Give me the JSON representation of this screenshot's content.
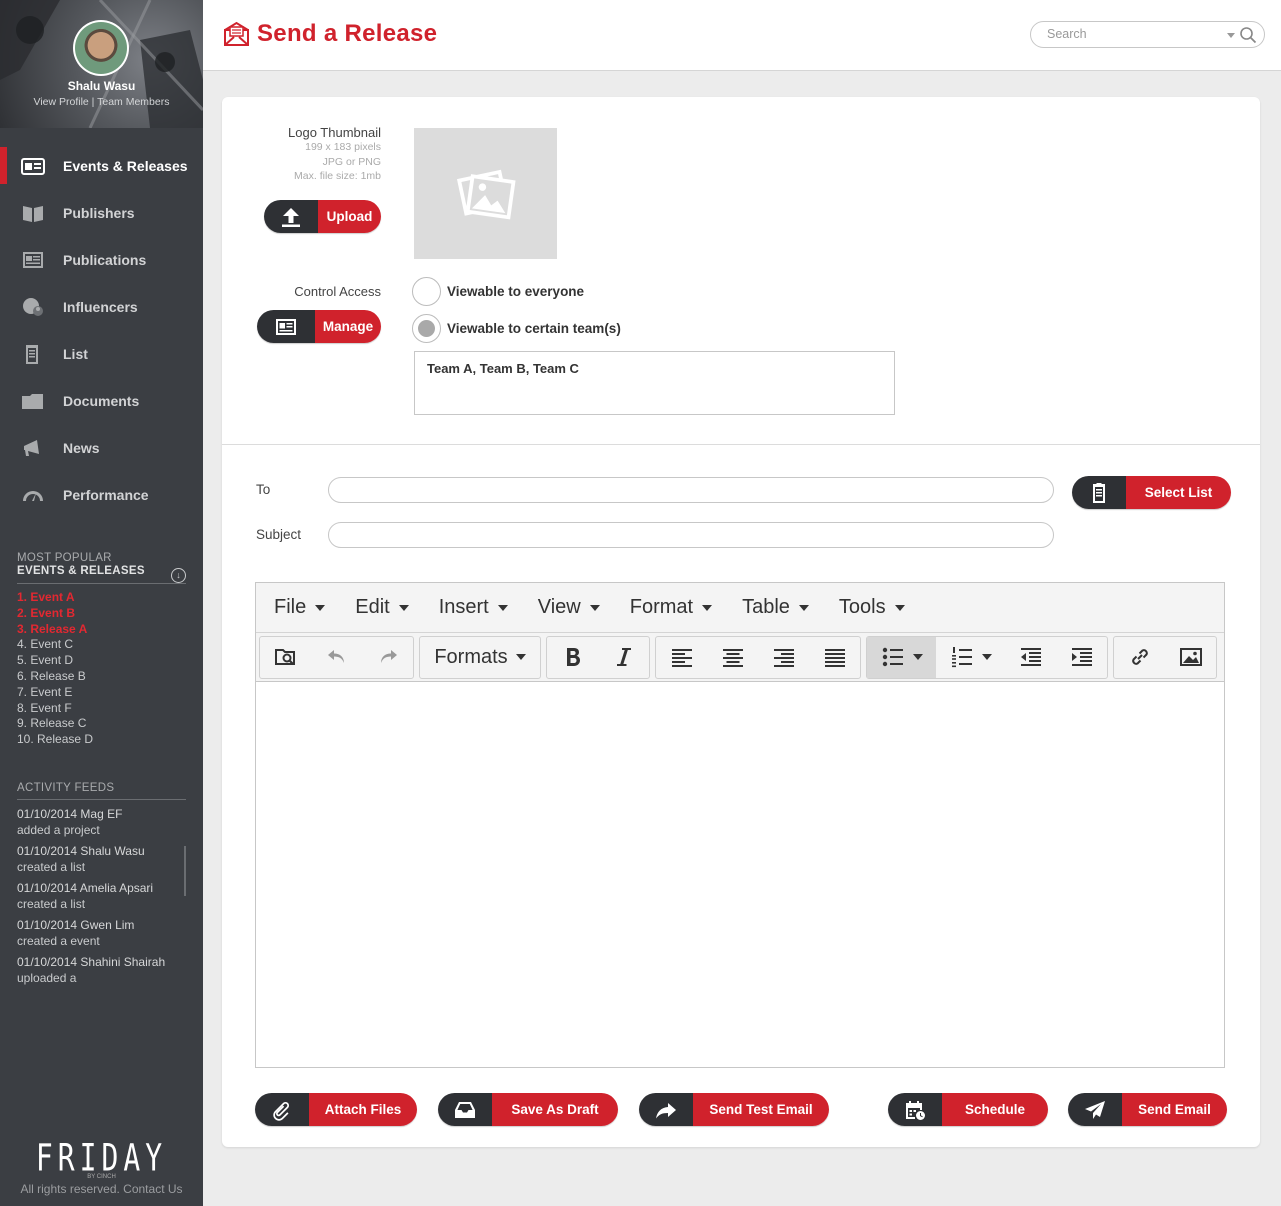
{
  "profile": {
    "name": "Shalu Wasu",
    "links": "View Profile | Team Members"
  },
  "nav": [
    {
      "label": "Events & Releases",
      "icon": "events-icon",
      "active": true
    },
    {
      "label": "Publishers",
      "icon": "book-icon"
    },
    {
      "label": "Publications",
      "icon": "newspaper-icon"
    },
    {
      "label": "Influencers",
      "icon": "influencers-icon"
    },
    {
      "label": "List",
      "icon": "clipboard-icon"
    },
    {
      "label": "Documents",
      "icon": "folder-icon"
    },
    {
      "label": "News",
      "icon": "megaphone-icon"
    },
    {
      "label": "Performance",
      "icon": "gauge-icon"
    }
  ],
  "popular": {
    "heading_line1": "MOST POPULAR",
    "heading_line2": "EVENTS & RELEASES",
    "items": [
      "1. Event A",
      "2. Event B",
      "3. Release A",
      "4. Event C",
      "5. Event D",
      "6. Release B",
      "7. Event E",
      "8. Event F",
      "9. Release C",
      "10. Release D"
    ]
  },
  "feeds": {
    "heading": "ACTIVITY FEEDS",
    "items": [
      {
        "line1": "01/10/2014 Mag EF",
        "line2": "added a project"
      },
      {
        "line1": "01/10/2014 Shalu Wasu",
        "line2": "created a list"
      },
      {
        "line1": "01/10/2014 Amelia Apsari",
        "line2": "created a list"
      },
      {
        "line1": "01/10/2014 Gwen Lim",
        "line2": "created a event"
      },
      {
        "line1": "01/10/2014 Shahini Shairah",
        "line2": "uploaded a"
      }
    ]
  },
  "brand": {
    "logo": "FRIDAY",
    "by": "BY CINCH",
    "footer": "All rights reserved. Contact Us"
  },
  "header": {
    "title": "Send a Release",
    "search_placeholder": "Search"
  },
  "logo_section": {
    "label": "Logo Thumbnail",
    "hint1": "199 x 183 pixels",
    "hint2": "JPG or PNG",
    "hint3": "Max. file size: 1mb",
    "upload_label": "Upload"
  },
  "access": {
    "label": "Control Access",
    "manage_label": "Manage",
    "option_everyone": "Viewable to everyone",
    "option_teams": "Viewable to certain team(s)",
    "selected": "teams",
    "teams_value": "Team A, Team B, Team C"
  },
  "compose": {
    "to_label": "To",
    "subject_label": "Subject",
    "to_value": "",
    "subject_value": "",
    "select_list_label": "Select List"
  },
  "editor": {
    "menus": [
      "File",
      "Edit",
      "Insert",
      "View",
      "Format",
      "Table",
      "Tools"
    ],
    "formats_label": "Formats"
  },
  "actions": {
    "attach": "Attach Files",
    "draft": "Save As Draft",
    "test": "Send Test Email",
    "schedule": "Schedule",
    "send": "Send Email"
  },
  "colors": {
    "accent": "#d0222c",
    "sidebar": "#3b3e43",
    "pill_icon": "#2e3034"
  }
}
